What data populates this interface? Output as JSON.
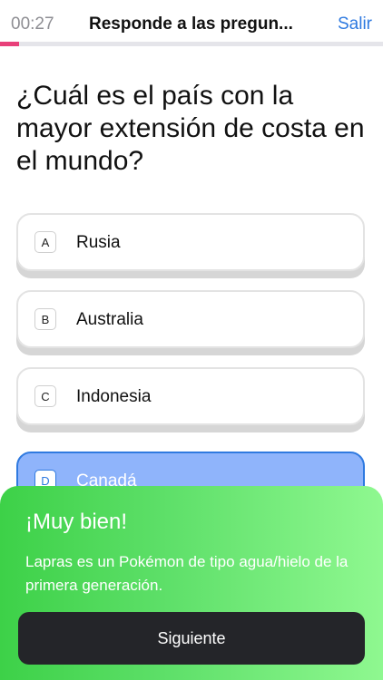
{
  "header": {
    "timer": "00:27",
    "title": "Responde a las pregun...",
    "exit_label": "Salir",
    "progress_fraction": 0.05
  },
  "question": "¿Cuál es el país con la mayor extensión de costa en el mundo?",
  "options": [
    {
      "letter": "A",
      "label": "Rusia"
    },
    {
      "letter": "B",
      "label": "Australia"
    },
    {
      "letter": "C",
      "label": "Indonesia"
    },
    {
      "letter": "D",
      "label": "Canadá",
      "selected": true
    }
  ],
  "feedback": {
    "title": "¡Muy bien!",
    "text": "Lapras es un Pokémon de tipo agua/hielo de la primera generación.",
    "next_label": "Siguiente"
  },
  "colors": {
    "accent": "#2f7ae0",
    "progress": "#e8407a",
    "success": "#3dd148",
    "selected_bg": "#8fb4fb",
    "button_bg": "#242529"
  }
}
